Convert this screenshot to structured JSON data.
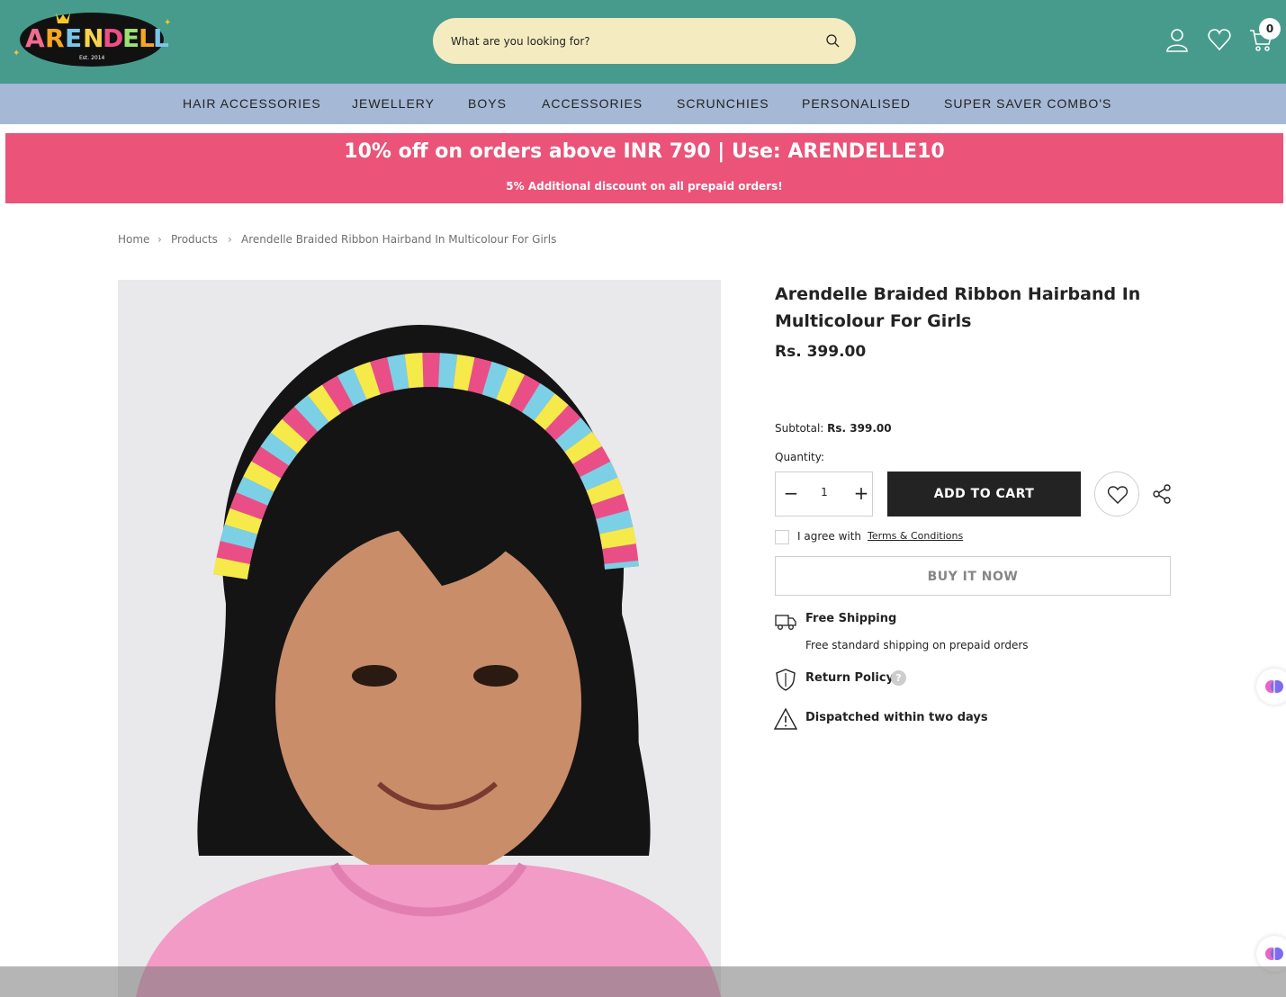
{
  "brand": {
    "logo_text": "ARENDELLE",
    "logo_tagline": "Est. 2014"
  },
  "header": {
    "search_placeholder": "What are you looking for?",
    "cart_count": "0"
  },
  "nav": {
    "items": [
      "HAIR ACCESSORIES",
      "JEWELLERY",
      "BOYS",
      "ACCESSORIES",
      "SCRUNCHIES",
      "PERSONALISED",
      "SUPER SAVER COMBO'S"
    ]
  },
  "promo": {
    "headline": "10% off on orders above INR 790 | Use: ARENDELLE10",
    "subline": "5% Additional discount on all prepaid orders!"
  },
  "breadcrumb": {
    "home": "Home",
    "products": "Products",
    "current": "Arendelle Braided Ribbon Hairband In Multicolour For Girls"
  },
  "product": {
    "title": "Arendelle Braided Ribbon Hairband In Multicolour For Girls",
    "price": "Rs. 399.00",
    "subtotal_label": "Subtotal:",
    "subtotal_value": "Rs. 399.00",
    "quantity_label": "Quantity:",
    "quantity_value": "1",
    "add_to_cart": "ADD TO CART",
    "agree_text": "I agree with",
    "terms_link": "Terms & Conditions",
    "buy_now": "BUY IT NOW"
  },
  "info": {
    "shipping_title": "Free Shipping",
    "shipping_desc": "Free standard shipping on prepaid orders",
    "return_title": "Return Policy",
    "help_mark": "?",
    "dispatch_title": "Dispatched within two days"
  },
  "colors": {
    "header_bg": "#479b8c",
    "nav_bg": "#a5b8d5",
    "promo_bg": "#eb5379",
    "search_bg": "#f5ebc1",
    "button_dark": "#232323"
  }
}
